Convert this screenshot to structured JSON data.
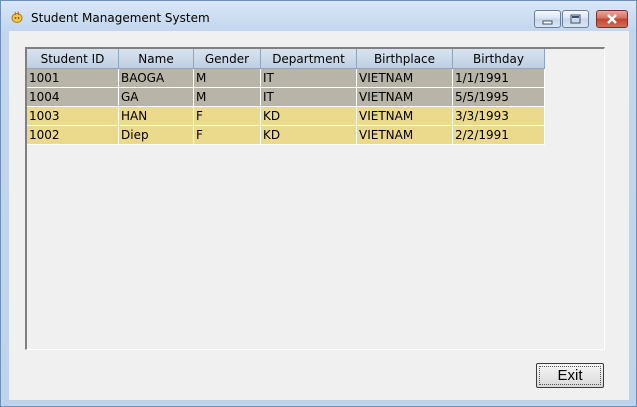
{
  "window": {
    "title": "Student Management System",
    "icon": "java-cup-icon",
    "controls": [
      "minimize-icon",
      "maximize-icon",
      "close-icon"
    ]
  },
  "table": {
    "columns": [
      "Student ID",
      "Name",
      "Gender",
      "Department",
      "Birthplace",
      "Birthday"
    ],
    "rows": [
      [
        "1001",
        "BAOGA",
        "M",
        "IT",
        "VIETNAM",
        "1/1/1991"
      ],
      [
        "1004",
        "GA",
        "M",
        "IT",
        "VIETNAM",
        "5/5/1995"
      ],
      [
        "1003",
        "HAN",
        "F",
        "KD",
        "VIETNAM",
        "3/3/1993"
      ],
      [
        "1002",
        "Diep",
        "F",
        "KD",
        "VIETNAM",
        "2/2/1991"
      ]
    ],
    "row_colors": [
      "#b8b4a8",
      "#b8b4a8",
      "#ecda8c",
      "#ecda8c"
    ]
  },
  "buttons": {
    "exit_label": "Exit"
  }
}
